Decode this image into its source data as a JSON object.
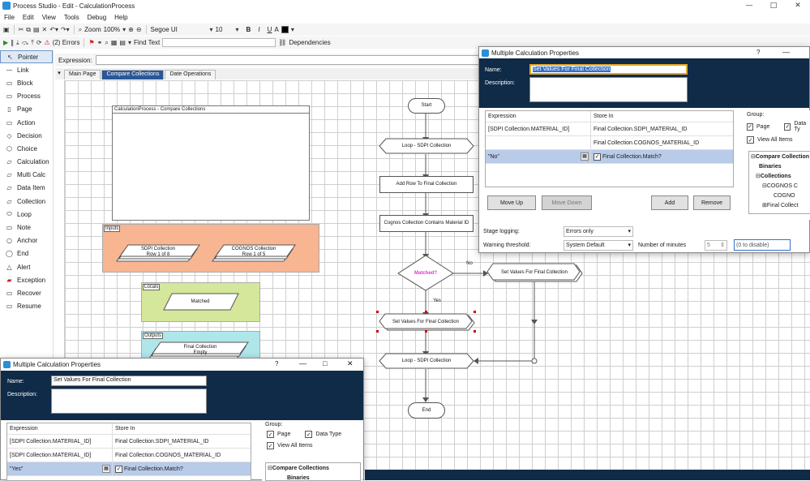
{
  "app": {
    "title": "Process Studio  - Edit - CalculationProcess",
    "window_controls": [
      "—",
      "□",
      "✕"
    ]
  },
  "menu": [
    "File",
    "Edit",
    "View",
    "Tools",
    "Debug",
    "Help"
  ],
  "toolbar": {
    "zoom_label": "Zoom",
    "zoom_value": "100%",
    "font_name": "Segoe UI",
    "font_size": "10",
    "bold": "B",
    "italic": "I",
    "underline": "U",
    "errors_label": "(2) Errors",
    "find_text_label": "Find Text",
    "dependencies_label": "Dependencies"
  },
  "toolbox": [
    "Pointer",
    "Link",
    "Block",
    "Process",
    "Page",
    "Action",
    "Decision",
    "Choice",
    "Calculation",
    "Multi Calc",
    "Data Item",
    "Collection",
    "Loop",
    "Note",
    "Anchor",
    "End",
    "Alert",
    "Exception",
    "Recover",
    "Resume"
  ],
  "expression_label": "Expression:",
  "tabs": [
    "Main Page",
    "Compare Collections",
    "Date Operations"
  ],
  "diagram": {
    "page_block_title": "CalculationProcess - Compare Collections",
    "inputs_label": "Inputs",
    "locals_label": "Locals",
    "outputs_label": "Outputs",
    "sdpi": {
      "name": "SDPI Collection",
      "rows": "Row 1 of 8"
    },
    "cognos": {
      "name": "COGNOS Collection",
      "rows": "Row 1 of 5"
    },
    "matched": "Matched",
    "final_collection": {
      "name": "Final Collection",
      "rows": "Empty"
    },
    "start": "Start",
    "loop_start": "Loop - SDPI Collection",
    "add_row": "Add Row To Final Collection",
    "contains": "Cognos Collection Contains Material ID",
    "decision": "Matched?",
    "no_label": "No",
    "yes_label": "Yes",
    "set_values_no": "Set Values For Final Collection",
    "set_values_yes": "Set Values For Final Collection",
    "loop_end": "Loop - SDPI Collection",
    "end": "End"
  },
  "dialog_top": {
    "title": "Multiple Calculation Properties",
    "help": "?",
    "name_label": "Name:",
    "name_value": "Set Values For Final Collection",
    "description_label": "Description:",
    "columns": [
      "Expression",
      "Store In"
    ],
    "rows": [
      {
        "expr": "[SDPI Collection.MATERIAL_ID]",
        "store": "Final Collection.SDPI_MATERIAL_ID"
      },
      {
        "expr": "",
        "store": "Final Collection.COGNOS_MATERIAL_ID"
      },
      {
        "expr": "\"No\"",
        "store": "Final Collection.Match?"
      }
    ],
    "buttons": {
      "move_up": "Move Up",
      "move_down": "Move Down",
      "add": "Add",
      "remove": "Remove"
    },
    "group_label": "Group:",
    "page_check": "Page",
    "datatype_check": "Data Ty",
    "view_all": "View All Items",
    "tree": [
      "Compare Collection",
      "Binaries",
      "Collections",
      "COGNOS C",
      "COGNO",
      "Final Collect"
    ],
    "stage_logging_label": "Stage logging:",
    "stage_logging_value": "Errors only",
    "warning_label": "Warning threshold:",
    "warning_value": "System Default",
    "minutes_label": "Number of minutes",
    "minutes_value": "5",
    "disable_hint": "(0 to disable)"
  },
  "dialog_bottom": {
    "title": "Multiple Calculation Properties",
    "help": "?",
    "name_label": "Name:",
    "name_value": "Set Values For Final Collection",
    "description_label": "Description:",
    "columns": [
      "Expression",
      "Store In"
    ],
    "rows": [
      {
        "expr": "[SDPI Collection.MATERIAL_ID]",
        "store": "Final Collection.SDPI_MATERIAL_ID"
      },
      {
        "expr": "[SDPI Collection.MATERIAL_ID]",
        "store": "Final Collection.COGNOS_MATERIAL_ID"
      },
      {
        "expr": "\"Yes\"",
        "store": "Final Collection.Match?"
      }
    ],
    "group_label": "Group:",
    "page_check": "Page",
    "datatype_check": "Data Type",
    "view_all": "View All Items",
    "tree": [
      "Compare Collections",
      "Binaries"
    ]
  },
  "colors": {
    "dialog_header": "#0f2b48",
    "tab_selected": "#2b5797",
    "inputs_fill": "#f7b591",
    "locals_fill": "#d4e79a",
    "outputs_fill": "#aee6ea",
    "decision_text": "#d63ad6"
  }
}
